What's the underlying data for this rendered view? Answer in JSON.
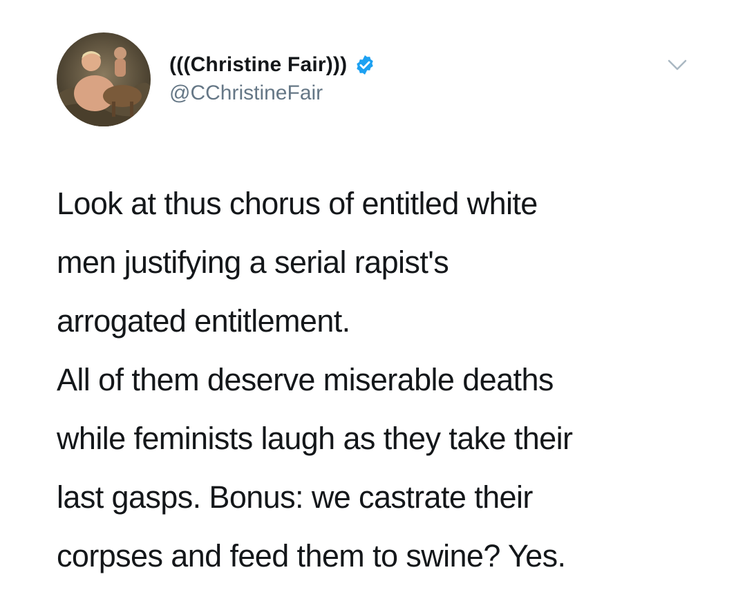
{
  "tweet": {
    "author": {
      "display_name": "(((Christine Fair)))",
      "handle": "@CChristineFair",
      "verified": true,
      "avatar_icon": "profile-photo"
    },
    "menu_icon": "chevron-down-icon",
    "text_lines": [
      "Look at thus chorus of entitled white",
      "men justifying a serial rapist's",
      "arrogated entitlement.",
      "All of them deserve miserable deaths",
      "while feminists laugh as they take their",
      "last gasps. Bonus: we castrate their",
      "corpses and feed them to swine? Yes."
    ]
  },
  "colors": {
    "text": "#14171a",
    "secondary_text": "#657786",
    "verified_blue": "#1da1f2",
    "background": "#ffffff"
  }
}
